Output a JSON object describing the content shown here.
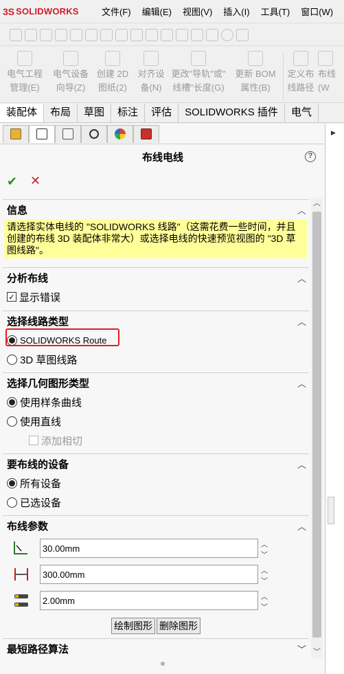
{
  "app": {
    "logo_ds": "3S",
    "logo_text": "SOLIDWORKS"
  },
  "menu": [
    "文件(F)",
    "编辑(E)",
    "视图(V)",
    "插入(I)",
    "工具(T)",
    "窗口(W)"
  ],
  "commands": [
    {
      "line1": "电气工程",
      "line2": "管理(E)"
    },
    {
      "line1": "电气设备",
      "line2": "向导(Z)"
    },
    {
      "line1": "创建 2D",
      "line2": "图纸(2)"
    },
    {
      "line1": "对齐设",
      "line2": "备(N)"
    },
    {
      "line1": "更改\"导轨\"或\"",
      "line2": "线槽\"长度(G)"
    },
    {
      "line1": "更新 BOM",
      "line2": "属性(B)"
    },
    {
      "line1": "定义布",
      "line2": "线路径"
    },
    {
      "line1": "布线",
      "line2": "(W"
    }
  ],
  "tabs": [
    "装配体",
    "布局",
    "草图",
    "标注",
    "评估",
    "SOLIDWORKS 插件",
    "电气"
  ],
  "panel": {
    "title": "布线电线",
    "help": "?",
    "ok": "✔",
    "cancel": "✕",
    "info": {
      "header": "信息",
      "text": "请选择实体电线的 \"SOLIDWORKS 线路\"（这需花费一些时间，并且创建的布线 3D 装配体非常大）或选择电线的快速预览视图的 \"3D 草图线路\"。"
    },
    "analysis": {
      "header": "分析布线",
      "show_errors": "显示错误"
    },
    "route_type": {
      "header": "选择线路类型",
      "opt1": "SOLIDWORKS Route",
      "opt2": "3D 草图线路"
    },
    "geometry": {
      "header": "选择几何图形类型",
      "opt1": "使用样条曲线",
      "opt2": "使用直线",
      "add_tangent": "添加相切"
    },
    "devices": {
      "header": "要布线的设备",
      "opt1": "所有设备",
      "opt2": "已选设备"
    },
    "params": {
      "header": "布线参数",
      "v1": "30.00mm",
      "v2": "300.00mm",
      "v3": "2.00mm",
      "draw_btn": "绘制图形",
      "delete_btn": "删除图形"
    },
    "algo": {
      "header": "最短路径算法"
    }
  }
}
